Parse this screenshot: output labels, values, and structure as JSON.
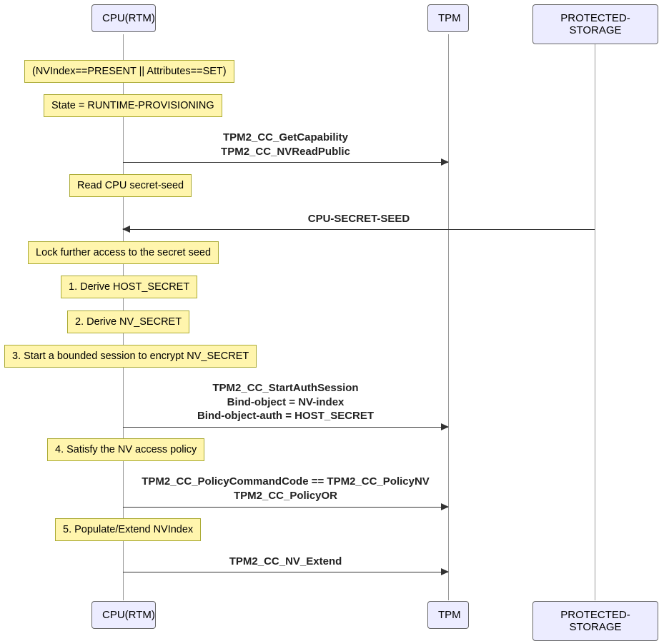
{
  "participants": {
    "cpu": "CPU(RTM)",
    "tpm": "TPM",
    "storage": "PROTECTED-STORAGE"
  },
  "notes": {
    "n1": "(NVIndex==PRESENT || Attributes==SET)",
    "n2": "State = RUNTIME-PROVISIONING",
    "n3": "Read CPU secret-seed",
    "n4": "Lock further access to the secret seed",
    "n5": "1. Derive HOST_SECRET",
    "n6": "2. Derive NV_SECRET",
    "n7": "3. Start a bounded session to encrypt NV_SECRET",
    "n8": "4. Satisfy the NV access policy",
    "n9": "5. Populate/Extend NVIndex"
  },
  "messages": {
    "m1": "TPM2_CC_GetCapability\nTPM2_CC_NVReadPublic",
    "m2": "CPU-SECRET-SEED",
    "m3": "TPM2_CC_StartAuthSession\nBind-object = NV-index\nBind-object-auth = HOST_SECRET",
    "m4": "TPM2_CC_PolicyCommandCode == TPM2_CC_PolicyNV\nTPM2_CC_PolicyOR",
    "m5": "TPM2_CC_NV_Extend"
  },
  "chart_data": {
    "type": "sequence-diagram",
    "participants": [
      "CPU(RTM)",
      "TPM",
      "PROTECTED-STORAGE"
    ],
    "sequence": [
      {
        "type": "note",
        "over": "CPU(RTM)",
        "text": "(NVIndex==PRESENT || Attributes==SET)"
      },
      {
        "type": "note",
        "over": "CPU(RTM)",
        "text": "State = RUNTIME-PROVISIONING"
      },
      {
        "type": "message",
        "from": "CPU(RTM)",
        "to": "TPM",
        "text": "TPM2_CC_GetCapability\nTPM2_CC_NVReadPublic"
      },
      {
        "type": "note",
        "over": "CPU(RTM)",
        "text": "Read CPU secret-seed"
      },
      {
        "type": "message",
        "from": "PROTECTED-STORAGE",
        "to": "CPU(RTM)",
        "text": "CPU-SECRET-SEED"
      },
      {
        "type": "note",
        "over": "CPU(RTM)",
        "text": "Lock further access to the secret seed"
      },
      {
        "type": "note",
        "over": "CPU(RTM)",
        "text": "1. Derive HOST_SECRET"
      },
      {
        "type": "note",
        "over": "CPU(RTM)",
        "text": "2. Derive NV_SECRET"
      },
      {
        "type": "note",
        "over": "CPU(RTM)",
        "text": "3. Start a bounded session to encrypt NV_SECRET"
      },
      {
        "type": "message",
        "from": "CPU(RTM)",
        "to": "TPM",
        "text": "TPM2_CC_StartAuthSession\nBind-object = NV-index\nBind-object-auth = HOST_SECRET"
      },
      {
        "type": "note",
        "over": "CPU(RTM)",
        "text": "4. Satisfy the NV access policy"
      },
      {
        "type": "message",
        "from": "CPU(RTM)",
        "to": "TPM",
        "text": "TPM2_CC_PolicyCommandCode == TPM2_CC_PolicyNV\nTPM2_CC_PolicyOR"
      },
      {
        "type": "note",
        "over": "CPU(RTM)",
        "text": "5. Populate/Extend NVIndex"
      },
      {
        "type": "message",
        "from": "CPU(RTM)",
        "to": "TPM",
        "text": "TPM2_CC_NV_Extend"
      }
    ]
  }
}
